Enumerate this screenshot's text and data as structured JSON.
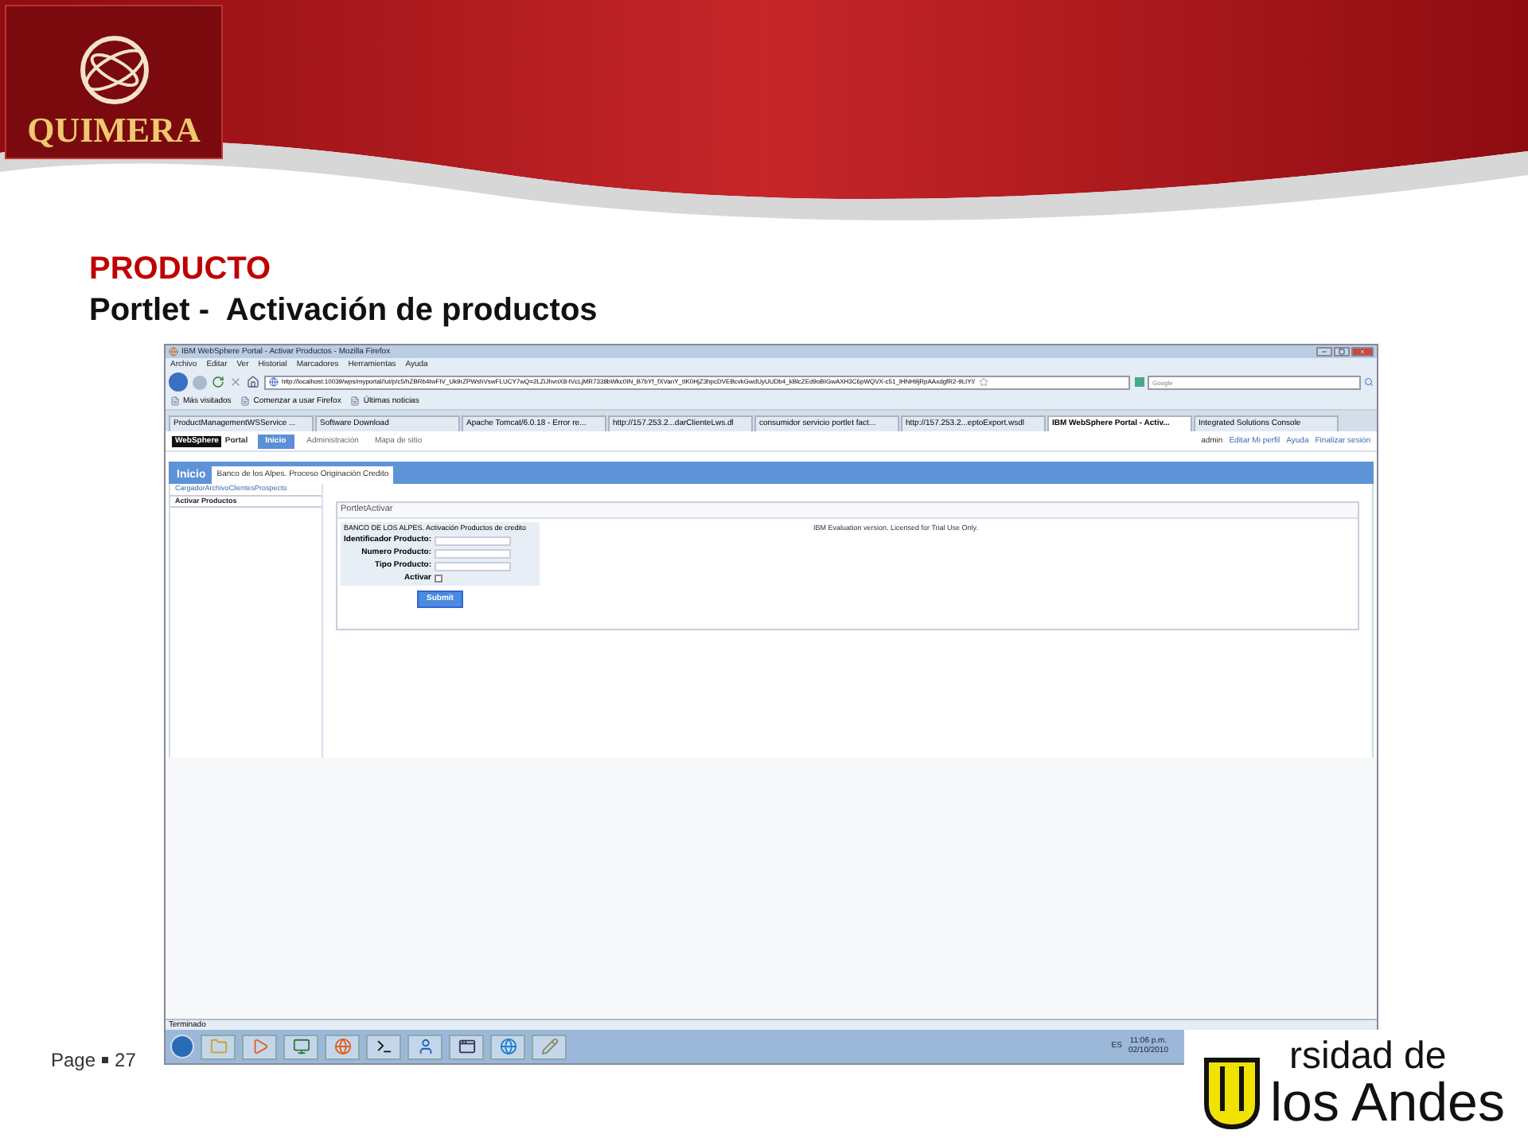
{
  "slide": {
    "logo_text": "QUIMERA",
    "title": "PRODUCTO",
    "subtitle": "Portlet -  Activación de productos",
    "page_label": "Page",
    "page_number": "27",
    "university_line_1": "rsidad de",
    "university_line_2": "los Andes"
  },
  "browser": {
    "window_title": "IBM WebSphere Portal - Activar Productos - Mozilla Firefox",
    "menu": [
      "Archivo",
      "Editar",
      "Ver",
      "Historial",
      "Marcadores",
      "Herramientas",
      "Ayuda"
    ],
    "url": "http://localhost:10039/wps/myportal/!ut/p/c5/hZBRb4IwFIV_Uk9rZPWshVswFLUCY7wQ=2LZiJhvnX8-tVcLjMR7338bWkc0IN_B7bYf_fXVanY_tIK0HjZ3hpcDVEBcvkGwdUyUUDb4_kBlcZEd9oBIGwAXH3C6pWQVX-c51_lHNH9jRpAAxdgfR2-9LIY!/",
    "search_placeholder": "Google",
    "bookmarks": [
      "Más visitados",
      "Comenzar a usar Firefox",
      "Últimas noticias"
    ],
    "tabs": [
      {
        "label": "ProductManagementWSService ...",
        "selected": false
      },
      {
        "label": "Software Download",
        "selected": false
      },
      {
        "label": "Apache Tomcat/6.0.18 - Error re...",
        "selected": false
      },
      {
        "label": "http://157.253.2...darClienteLws.dl",
        "selected": false
      },
      {
        "label": "consumidor servicio portlet fact...",
        "selected": false
      },
      {
        "label": "http://157.253.2...eptoExport.wsdl",
        "selected": false
      },
      {
        "label": "IBM WebSphere Portal - Activ...",
        "selected": true
      },
      {
        "label": "Integrated Solutions Console",
        "selected": false
      }
    ],
    "status": "Terminado"
  },
  "portal": {
    "brand": "WebSphere",
    "brand_suffix": "Portal",
    "nav": [
      {
        "label": "Inicio",
        "selected": true
      },
      {
        "label": "Administración",
        "selected": false
      },
      {
        "label": "Mapa de sitio",
        "selected": false
      }
    ],
    "user_links": [
      "admin",
      "Editar Mi perfil",
      "Ayuda",
      "Finalizar sesión"
    ],
    "page_tabs": [
      {
        "label": "Inicio",
        "selected": false
      },
      {
        "label": "Banco de los Alpes. Proceso Originación Credito",
        "selected": true
      }
    ],
    "sidebar": [
      {
        "label": "CargadorArchivoClientesProspecto",
        "selected": false
      },
      {
        "label": "Activar Productos",
        "selected": true
      }
    ],
    "portlet_title": "PortletActivar",
    "form_heading": "BANCO DE LOS ALPES. Activación Productos de credito",
    "fields": [
      {
        "label": "Identificador Producto:"
      },
      {
        "label": "Numero Producto:"
      },
      {
        "label": "Tipo Producto:"
      }
    ],
    "checkbox": {
      "label": "Activar",
      "checked": false
    },
    "submit": "Submit",
    "notice": "IBM Evaluation version. Licensed for Trial Use Only."
  },
  "taskbar": {
    "language": "ES",
    "time": "11:06 p.m.",
    "date": "02/10/2010"
  }
}
